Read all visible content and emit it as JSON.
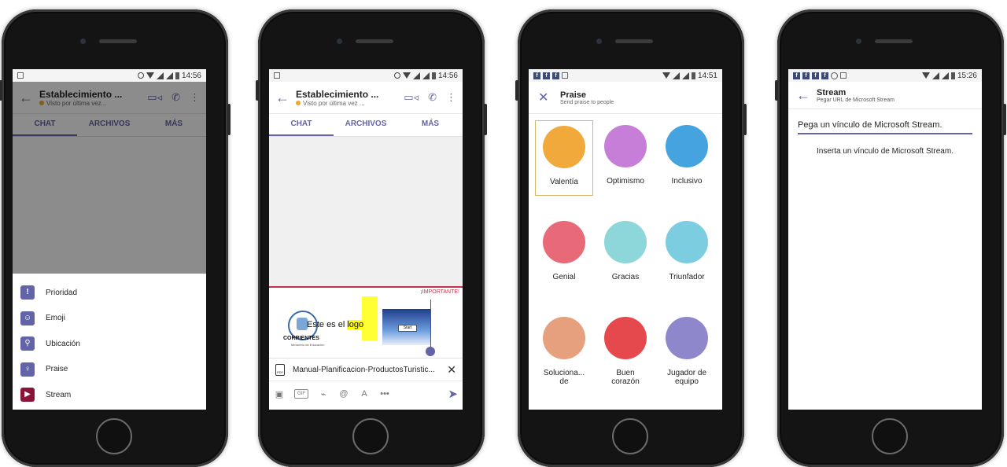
{
  "phone1": {
    "status": {
      "time": "14:56"
    },
    "header": {
      "title": "Establecimiento ...",
      "subtitle": "Visto por última vez..."
    },
    "tabs": [
      "CHAT",
      "ARCHIVOS",
      "MÁS"
    ],
    "menu": [
      {
        "label": "Prioridad",
        "icon": "!"
      },
      {
        "label": "Emoji",
        "icon": "☺"
      },
      {
        "label": "Ubicación",
        "icon": "⚲"
      },
      {
        "label": "Praise",
        "icon": "♀"
      },
      {
        "label": "Stream",
        "icon": "▶"
      }
    ]
  },
  "phone2": {
    "status": {
      "time": "14:56"
    },
    "header": {
      "title": "Establecimiento ...",
      "subtitle": "Visto por última vez ..."
    },
    "tabs": [
      "CHAT",
      "ARCHIVOS",
      "MÁS"
    ],
    "important": "¡IMPORTANTE!",
    "compose": {
      "logo_text": "CORRIENTES",
      "logo_sub": "Ministerio de Educación",
      "text_before": "Este es el ",
      "text_highlight": "logo",
      "start_label": "Start"
    },
    "attachment": {
      "name": "Manual-Planificacion-ProductosTuristic...",
      "badge": "PDF"
    },
    "toolbar": [
      "▣",
      "GIF",
      "⌁",
      "@",
      "A",
      "•••"
    ]
  },
  "phone3": {
    "status": {
      "time": "14:51"
    },
    "header": {
      "title": "Praise",
      "subtitle": "Send praise to people"
    },
    "badges": [
      {
        "label": "Valentía",
        "color": "#f2a93b"
      },
      {
        "label": "Optimismo",
        "color": "#c67ed8"
      },
      {
        "label": "Inclusivo",
        "color": "#45a3e0"
      },
      {
        "label": "Genial",
        "color": "#e86a79"
      },
      {
        "label": "Gracias",
        "color": "#8dd6d9"
      },
      {
        "label": "Triunfador",
        "color": "#7ccde0"
      },
      {
        "label": "Soluciona...\nde",
        "color": "#e6a07e"
      },
      {
        "label": "Buen\ncorazón",
        "color": "#e5484d"
      },
      {
        "label": "Jugador de\nequipo",
        "color": "#8f87cc"
      }
    ]
  },
  "phone4": {
    "status": {
      "time": "15:26"
    },
    "header": {
      "title": "Stream",
      "subtitle": "Pegar URL de Microsoft Stream"
    },
    "input_placeholder": "Pega un vínculo de Microsoft Stream.",
    "hint": "Inserta un vínculo de Microsoft Stream."
  },
  "colors": {
    "accent": "#6264a7",
    "important": "#c4314b"
  }
}
